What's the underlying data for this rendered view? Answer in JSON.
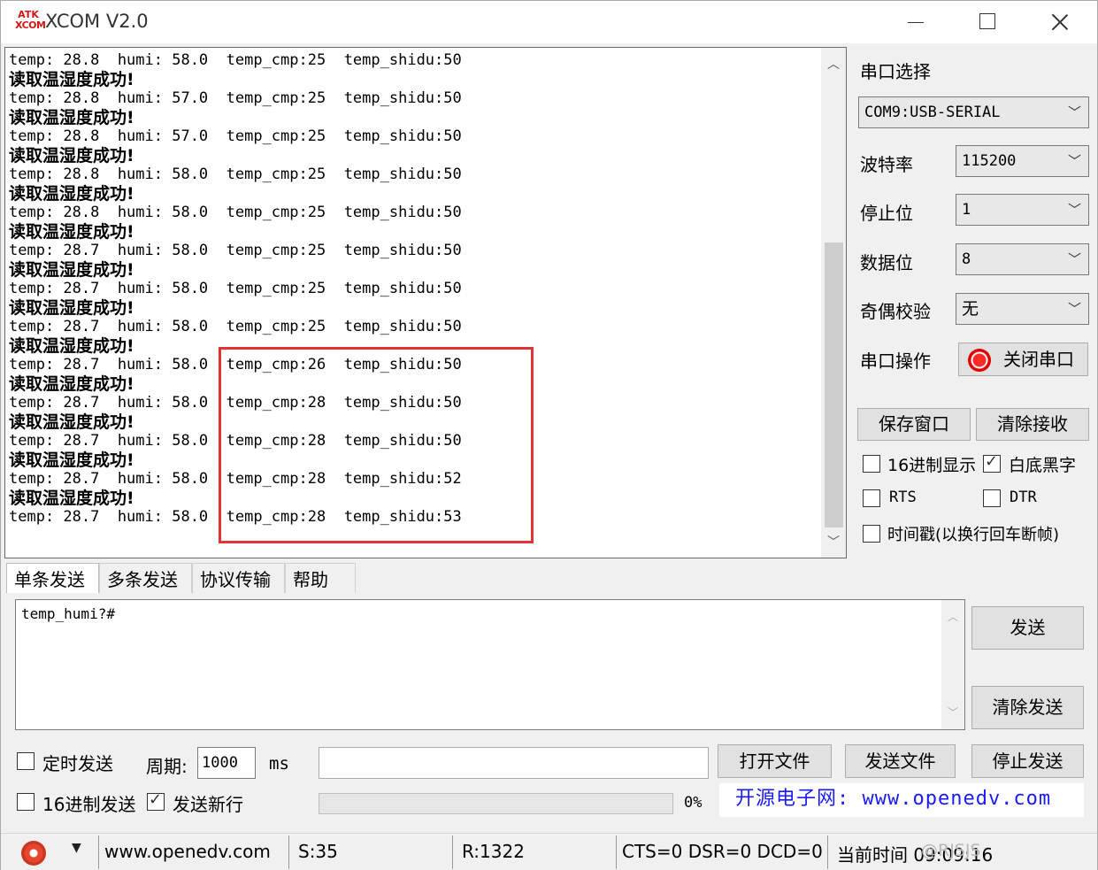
{
  "window": {
    "logo_top": "ATK",
    "logo_bottom": "XCOM",
    "title": "XCOM V2.0"
  },
  "receive": {
    "lines": [
      {
        "text": "temp: 28.8  humi: 58.0  temp_cmp:25  temp_shidu:50",
        "zh": false
      },
      {
        "text": "读取温湿度成功!",
        "zh": true
      },
      {
        "text": "temp: 28.8  humi: 57.0  temp_cmp:25  temp_shidu:50",
        "zh": false
      },
      {
        "text": "读取温湿度成功!",
        "zh": true
      },
      {
        "text": "temp: 28.8  humi: 57.0  temp_cmp:25  temp_shidu:50",
        "zh": false
      },
      {
        "text": "读取温湿度成功!",
        "zh": true
      },
      {
        "text": "temp: 28.8  humi: 58.0  temp_cmp:25  temp_shidu:50",
        "zh": false
      },
      {
        "text": "读取温湿度成功!",
        "zh": true
      },
      {
        "text": "temp: 28.8  humi: 58.0  temp_cmp:25  temp_shidu:50",
        "zh": false
      },
      {
        "text": "读取温湿度成功!",
        "zh": true
      },
      {
        "text": "temp: 28.7  humi: 58.0  temp_cmp:25  temp_shidu:50",
        "zh": false
      },
      {
        "text": "读取温湿度成功!",
        "zh": true
      },
      {
        "text": "temp: 28.7  humi: 58.0  temp_cmp:25  temp_shidu:50",
        "zh": false
      },
      {
        "text": "读取温湿度成功!",
        "zh": true
      },
      {
        "text": "temp: 28.7  humi: 58.0  temp_cmp:25  temp_shidu:50",
        "zh": false
      },
      {
        "text": "读取温湿度成功!",
        "zh": true
      },
      {
        "text": "temp: 28.7  humi: 58.0  temp_cmp:26  temp_shidu:50",
        "zh": false
      },
      {
        "text": "读取温湿度成功!",
        "zh": true
      },
      {
        "text": "temp: 28.7  humi: 58.0  temp_cmp:28  temp_shidu:50",
        "zh": false
      },
      {
        "text": "读取温湿度成功!",
        "zh": true
      },
      {
        "text": "temp: 28.7  humi: 58.0  temp_cmp:28  temp_shidu:50",
        "zh": false
      },
      {
        "text": "读取温湿度成功!",
        "zh": true
      },
      {
        "text": "temp: 28.7  humi: 58.0  temp_cmp:28  temp_shidu:52",
        "zh": false
      },
      {
        "text": "读取温湿度成功!",
        "zh": true
      },
      {
        "text": "temp: 28.7  humi: 58.0  temp_cmp:28  temp_shidu:53",
        "zh": false
      }
    ]
  },
  "settings": {
    "port_select_label": "串口选择",
    "port_value": "COM9:USB-SERIAL",
    "baud_label": "波特率",
    "baud_value": "115200",
    "stop_label": "停止位",
    "stop_value": "1",
    "data_label": "数据位",
    "data_value": "8",
    "parity_label": "奇偶校验",
    "parity_value": "无",
    "port_op_label": "串口操作",
    "close_port_label": "关闭串口",
    "save_window_label": "保存窗口",
    "clear_recv_label": "清除接收",
    "hex_display_label": "16进制显示",
    "hex_display_checked": false,
    "white_bg_label": "白底黑字",
    "white_bg_checked": true,
    "rts_label": "RTS",
    "rts_checked": false,
    "dtr_label": "DTR",
    "dtr_checked": false,
    "timestamp_label": "时间戳(以换行回车断帧)",
    "timestamp_checked": false
  },
  "tabs": [
    "单条发送",
    "多条发送",
    "协议传输",
    "帮助"
  ],
  "send": {
    "text": "temp_humi?#",
    "send_label": "发送",
    "clear_send_label": "清除发送",
    "timed_send_label": "定时发送",
    "timed_send_checked": false,
    "period_label": "周期:",
    "period_value": "1000",
    "period_unit": "ms",
    "open_file_label": "打开文件",
    "send_file_label": "发送文件",
    "stop_send_label": "停止发送",
    "hex_send_label": "16进制发送",
    "hex_send_checked": false,
    "newline_label": "发送新行",
    "newline_checked": true,
    "progress_pct": 0,
    "progress_text": "0%",
    "promo_text": "开源电子网: www.openedv.com"
  },
  "status": {
    "url": "www.openedv.com",
    "sent": "S:35",
    "received": "R:1322",
    "lines": "CTS=0 DSR=0 DCD=0",
    "time": "当前时间 09:09:16",
    "watermark": "@RJSJS"
  },
  "colors": {
    "highlight": "#e53333",
    "promo": "#1a1aff",
    "progress": "#06b025"
  }
}
